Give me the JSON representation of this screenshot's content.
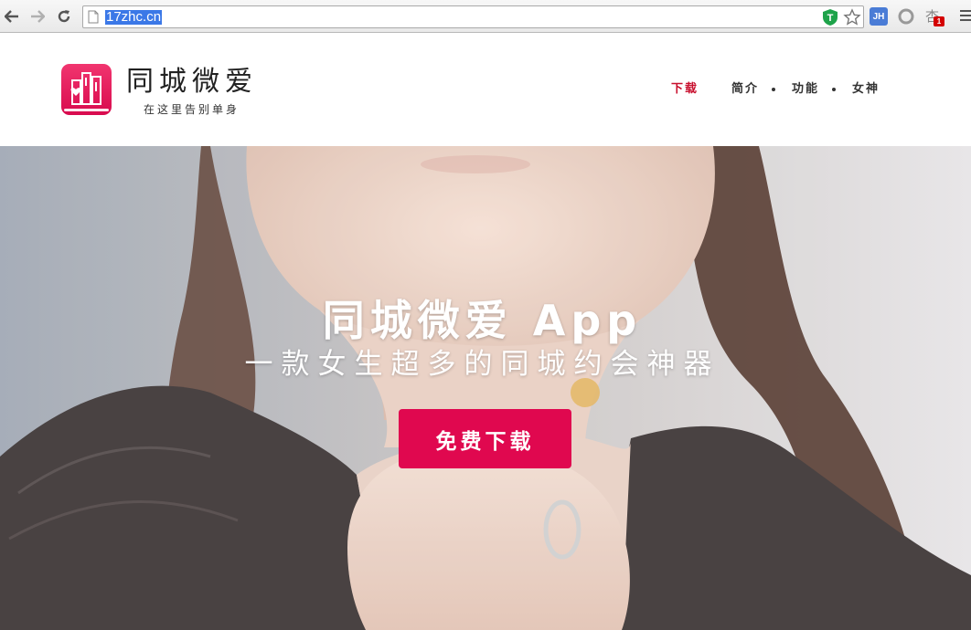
{
  "browser": {
    "url": "17zhc.cn",
    "extensions": [
      {
        "name": "shield-extension-icon",
        "label": "T"
      },
      {
        "name": "jh-extension-icon",
        "label": "JH"
      },
      {
        "name": "circle-extension-icon"
      },
      {
        "name": "ruby-extension-icon",
        "glyph": "杏",
        "badge": "1"
      }
    ]
  },
  "site": {
    "logo_title": "同城微爱",
    "logo_subtitle": "在这里告别单身",
    "nav": [
      {
        "label": "下载",
        "active": true
      },
      {
        "label": "简介",
        "active": false
      },
      {
        "label": "功能",
        "active": false
      },
      {
        "label": "女神",
        "active": false
      }
    ]
  },
  "hero": {
    "title": "同城微爱 App",
    "subtitle": "一款女生超多的同城约会神器",
    "cta_label": "免费下载"
  },
  "colors": {
    "accent": "#e0084f",
    "nav_active": "#c8102e",
    "logo_pink": "#e8145a"
  }
}
